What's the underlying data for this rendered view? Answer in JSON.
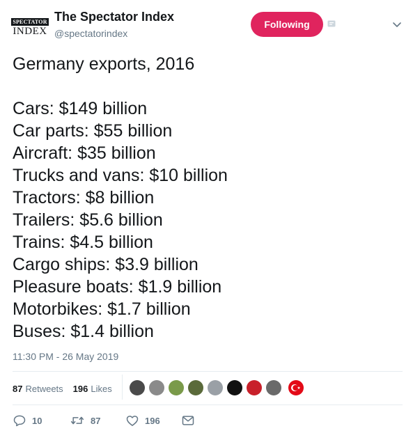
{
  "author": {
    "avatar_text_top": "SPECTATOR",
    "avatar_text_bottom": "INDEX",
    "name": "The Spectator Index",
    "handle": "@spectatorindex"
  },
  "follow_button": {
    "label": "Following",
    "color": "#e0245e"
  },
  "tweet": {
    "headline": "Germany exports, 2016",
    "lines": [
      "Cars: $149 billion",
      "Car parts: $55 billion",
      "Aircraft: $35 billion",
      "Trucks and vans: $10 billion",
      "Tractors: $8 billion",
      "Trailers: $5.6 billion",
      "Trains: $4.5 billion",
      "Cargo ships: $3.9 billion",
      "Pleasure boats: $1.9 billion",
      "Motorbikes: $1.7 billion",
      "Buses: $1.4 billion"
    ],
    "timestamp": "11:30 PM - 26 May 2019"
  },
  "stats": {
    "retweets_count": "87",
    "retweets_label": "Retweets",
    "likes_count": "196",
    "likes_label": "Likes"
  },
  "likers": [
    {
      "color": "#4a4a4a"
    },
    {
      "color": "#8a8a8a"
    },
    {
      "color": "#7a9a4a"
    },
    {
      "color": "#5a6a3a"
    },
    {
      "color": "#9aa0a6"
    },
    {
      "color": "#111111"
    },
    {
      "color": "#c8202a"
    },
    {
      "color": "#6a6a6a"
    },
    {
      "color": "#e30a17"
    }
  ],
  "actions": {
    "reply_count": "10",
    "retweet_count": "87",
    "like_count": "196"
  },
  "colors": {
    "muted": "#657786",
    "divider": "#e6ecf0"
  },
  "icons": [
    "reply-icon",
    "retweet-icon",
    "like-icon",
    "message-icon",
    "chevron-down-icon"
  ]
}
